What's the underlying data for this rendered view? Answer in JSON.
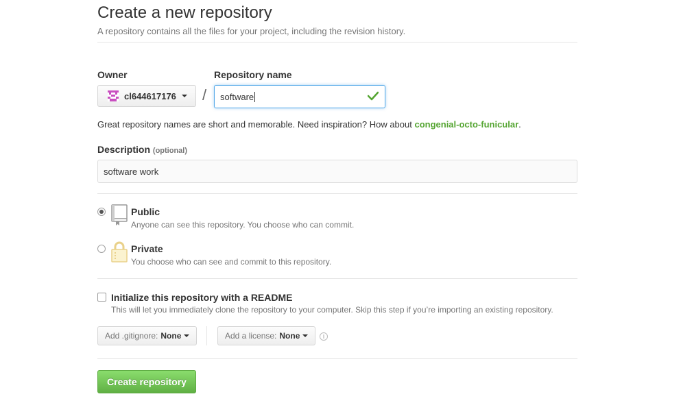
{
  "header": {
    "title": "Create a new repository",
    "subtitle": "A repository contains all the files for your project, including the revision history."
  },
  "owner": {
    "label": "Owner",
    "value": "cl644617176",
    "avatar_color": "#c94fc0"
  },
  "separator": "/",
  "repo_name": {
    "label": "Repository name",
    "value": "software",
    "valid_color": "#55a532"
  },
  "hint": {
    "text": "Great repository names are short and memorable. Need inspiration? How about ",
    "suggestion": "congenial-octo-funicular",
    "end": "."
  },
  "description": {
    "label": "Description",
    "optional": "(optional)",
    "value": "software work"
  },
  "visibility": {
    "public": {
      "title": "Public",
      "desc": "Anyone can see this repository. You choose who can commit.",
      "selected": true,
      "icon": "repo-book-icon"
    },
    "private": {
      "title": "Private",
      "desc": "You choose who can see and commit to this repository.",
      "selected": false,
      "icon": "lock-icon"
    }
  },
  "readme": {
    "title": "Initialize this repository with a README",
    "desc": "This will let you immediately clone the repository to your computer. Skip this step if you’re importing an existing repository.",
    "checked": false
  },
  "gitignore": {
    "prefix": "Add .gitignore:",
    "value": "None"
  },
  "license": {
    "prefix": "Add a license:",
    "value": "None"
  },
  "info_icon": "i",
  "submit": {
    "label": "Create repository",
    "color": "#60b044"
  }
}
